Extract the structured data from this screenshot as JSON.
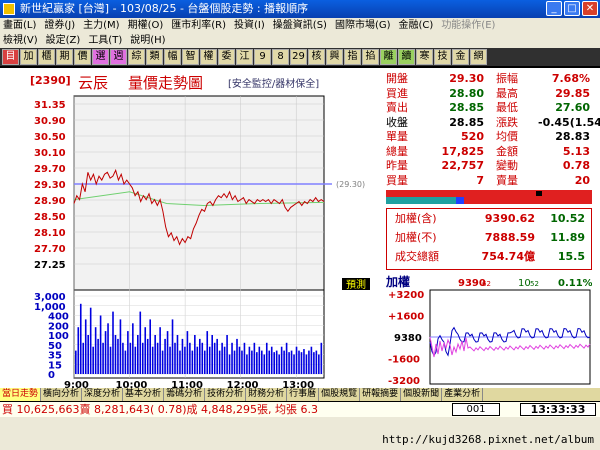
{
  "window": {
    "title": "新世紀贏家 [台灣] - 103/08/25 - 台盤個股走勢 : 播報順序",
    "btn_min": "_",
    "btn_max": "□",
    "btn_close": "✕"
  },
  "menu": {
    "row1": [
      "畫面(L)",
      "證券(J)",
      "主力(M)",
      "期權(O)",
      "匯市利率(R)",
      "投資(I)",
      "操盤資訊(S)",
      "國際市場(G)",
      "金融(C)",
      "功能操作(E)"
    ],
    "row2": [
      "檢視(V)",
      "設定(Z)",
      "工具(T)",
      "說明(H)"
    ]
  },
  "toolbar": [
    "目",
    "加",
    "櫃",
    "期",
    "價",
    "選",
    "週",
    "綜",
    "類",
    "幅",
    "智",
    "權",
    "委",
    "江",
    "9",
    "8",
    "29",
    "核",
    "興",
    "指",
    "掐",
    "離",
    "續",
    "寒",
    "技",
    "金",
    "網"
  ],
  "header": {
    "code": "[2390]",
    "name": "云辰",
    "chart_title": "量價走勢圖",
    "link": "[安全監控/器材保全]"
  },
  "quote": {
    "rows": [
      {
        "l1": "開盤",
        "v1": "29.30",
        "l2": "振幅",
        "v2": "7.68%",
        "c1": "#c00",
        "c2": "#c00"
      },
      {
        "l1": "買進",
        "v1": "28.80",
        "l2": "最高",
        "v2": "29.85",
        "c1": "#060",
        "c2": "#c00"
      },
      {
        "l1": "賣出",
        "v1": "28.85",
        "l2": "最低",
        "v2": "27.60",
        "c1": "#060",
        "c2": "#060"
      },
      {
        "l1": "收盤",
        "v1": "28.85",
        "l2": "漲跌",
        "v2": "-0.45(1.54)",
        "c1": "#000",
        "c2": "#000"
      },
      {
        "l1": "單量",
        "v1": "520",
        "l2": "均價",
        "v2": "28.83",
        "c1": "#c00",
        "c2": "#000"
      },
      {
        "l1": "總量",
        "v1": "17,825",
        "l2": "金額",
        "v2": "5.13",
        "c1": "#c00",
        "c2": "#c00"
      },
      {
        "l1": "昨量",
        "v1": "22,757",
        "l2": "變動",
        "v2": "0.78",
        "c1": "#c00",
        "c2": "#c00"
      },
      {
        "l1": "買量",
        "v1": "7",
        "l2": "賣量",
        "v2": "20",
        "c1": "#c00",
        "c2": "#c00"
      }
    ]
  },
  "index": {
    "rows": [
      {
        "label": "加權(含)",
        "value": "9390.62",
        "change": "10.52"
      },
      {
        "label": "加權(不)",
        "value": "7888.59",
        "change": "11.89"
      },
      {
        "label": "成交總額",
        "value": "754.74億",
        "change": "15.5"
      }
    ]
  },
  "mini": {
    "title": "加權",
    "value": "9390",
    "value_small": "62",
    "change": "10",
    "change_small": "52",
    "pct": "0.11%",
    "yticks": [
      "+3200",
      "+1600",
      "9380",
      "-1600",
      "-3200"
    ],
    "base_label": "10"
  },
  "chart_data": {
    "type": "line",
    "x_ticks": [
      "9:00",
      "10:00",
      "11:00",
      "12:00",
      "13:00"
    ],
    "price_ticks": [
      "31.35",
      "30.90",
      "30.50",
      "30.10",
      "29.70",
      "29.30",
      "28.90",
      "28.50",
      "28.10",
      "27.70",
      "27.25"
    ],
    "ref_label": "(29.30)",
    "pred_label": "預測",
    "volume_ticks": [
      "3,000",
      "1,000",
      "400",
      "200",
      "100",
      "50",
      "35",
      "15",
      "0"
    ],
    "ylim": [
      27.25,
      31.35
    ],
    "ref_price": 29.3,
    "price_series": [
      [
        0,
        28.8
      ],
      [
        3,
        29.0
      ],
      [
        6,
        28.9
      ],
      [
        9,
        29.3
      ],
      [
        12,
        29.1
      ],
      [
        15,
        29.6
      ],
      [
        18,
        29.4
      ],
      [
        21,
        29.55
      ],
      [
        24,
        29.3
      ],
      [
        27,
        29.5
      ],
      [
        30,
        29.4
      ],
      [
        33,
        29.55
      ],
      [
        36,
        29.6
      ],
      [
        39,
        29.45
      ],
      [
        42,
        29.5
      ],
      [
        45,
        29.65
      ],
      [
        48,
        29.4
      ],
      [
        51,
        29.55
      ],
      [
        54,
        29.3
      ],
      [
        57,
        29.4
      ],
      [
        60,
        29.3
      ],
      [
        63,
        29.2
      ],
      [
        66,
        29.0
      ],
      [
        69,
        29.1
      ],
      [
        72,
        28.85
      ],
      [
        75,
        29.0
      ],
      [
        78,
        28.9
      ],
      [
        81,
        29.05
      ],
      [
        84,
        28.8
      ],
      [
        87,
        28.9
      ],
      [
        90,
        28.75
      ],
      [
        93,
        28.9
      ],
      [
        96,
        28.6
      ],
      [
        99,
        28.2
      ],
      [
        102,
        27.95
      ],
      [
        105,
        28.05
      ],
      [
        108,
        27.85
      ],
      [
        111,
        27.95
      ],
      [
        114,
        27.75
      ],
      [
        117,
        27.9
      ],
      [
        120,
        27.8
      ],
      [
        123,
        27.95
      ],
      [
        126,
        27.9
      ],
      [
        129,
        28.15
      ],
      [
        132,
        28.3
      ],
      [
        135,
        28.5
      ],
      [
        138,
        28.65
      ],
      [
        141,
        28.6
      ],
      [
        144,
        28.8
      ],
      [
        147,
        28.85
      ],
      [
        150,
        28.75
      ],
      [
        153,
        28.9
      ],
      [
        156,
        29.0
      ],
      [
        159,
        28.95
      ],
      [
        162,
        29.05
      ],
      [
        165,
        28.95
      ],
      [
        168,
        29.1
      ],
      [
        171,
        28.9
      ],
      [
        174,
        29.0
      ],
      [
        177,
        28.85
      ],
      [
        180,
        28.9
      ],
      [
        183,
        28.95
      ],
      [
        186,
        28.8
      ],
      [
        189,
        28.9
      ],
      [
        192,
        28.85
      ],
      [
        195,
        28.8
      ],
      [
        198,
        28.9
      ],
      [
        201,
        28.85
      ],
      [
        204,
        28.9
      ],
      [
        207,
        28.85
      ],
      [
        210,
        28.9
      ],
      [
        213,
        28.8
      ],
      [
        216,
        28.9
      ],
      [
        219,
        28.85
      ],
      [
        222,
        28.8
      ],
      [
        225,
        28.9
      ],
      [
        228,
        28.7
      ],
      [
        231,
        28.6
      ],
      [
        234,
        28.7
      ],
      [
        237,
        28.75
      ],
      [
        240,
        28.8
      ],
      [
        243,
        28.85
      ],
      [
        246,
        28.75
      ],
      [
        249,
        28.85
      ],
      [
        252,
        28.8
      ],
      [
        255,
        28.9
      ],
      [
        258,
        28.85
      ],
      [
        261,
        28.95
      ],
      [
        264,
        28.85
      ],
      [
        267,
        28.9
      ],
      [
        270,
        28.85
      ]
    ],
    "avg_series": [
      [
        0,
        28.9
      ],
      [
        60,
        29.1
      ],
      [
        100,
        28.8
      ],
      [
        140,
        28.75
      ],
      [
        200,
        28.8
      ],
      [
        270,
        28.83
      ]
    ],
    "volume_series": [
      30,
      60,
      90,
      40,
      70,
      50,
      85,
      35,
      60,
      45,
      75,
      40,
      55,
      65,
      35,
      80,
      50,
      45,
      70,
      40,
      30,
      55,
      40,
      65,
      35,
      50,
      80,
      40,
      60,
      45,
      70,
      35,
      50,
      40,
      60,
      30,
      45,
      55,
      35,
      70,
      40,
      50,
      30,
      45,
      35,
      55,
      40,
      30,
      50,
      35,
      45,
      40,
      30,
      55,
      35,
      50,
      40,
      45,
      30,
      40,
      35,
      50,
      25,
      40,
      30,
      45,
      35,
      30,
      40,
      25,
      35,
      30,
      40,
      28,
      35,
      30,
      25,
      40,
      30,
      35,
      28,
      30,
      25,
      35,
      30,
      40,
      28,
      30,
      25,
      35,
      30,
      28,
      32,
      25,
      30,
      35,
      28,
      30,
      25,
      40
    ]
  },
  "tabs": [
    "當日走勢",
    "橫向分析",
    "深度分析",
    "基本分析",
    "籌碼分析",
    "技術分析",
    "財務分析",
    "行事曆",
    "個股規覽",
    "研報摘要",
    "個股新聞",
    "產業分析"
  ],
  "status": {
    "text": "買 10,625,663賣 8,281,643( 0.78)成 4,848,295張, 均張 6.3",
    "count": "001",
    "clock": "13:33:33"
  },
  "url": "http://kujd3268.pixnet.net/album"
}
